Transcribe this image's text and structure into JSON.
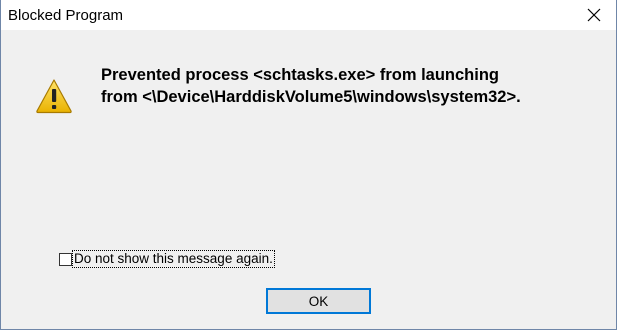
{
  "window": {
    "title": "Blocked Program"
  },
  "icons": {
    "close": "close-icon",
    "warning": "warning-icon"
  },
  "message": {
    "line1": "Prevented process <schtasks.exe> from launching",
    "line2": "from <\\Device\\HarddiskVolume5\\windows\\system32>."
  },
  "checkbox": {
    "label": "Do not show this message again.",
    "checked": false
  },
  "buttons": {
    "ok_label": "OK"
  },
  "colors": {
    "button_focus_border": "#0078d7",
    "warning_fill": "#f5c800"
  }
}
